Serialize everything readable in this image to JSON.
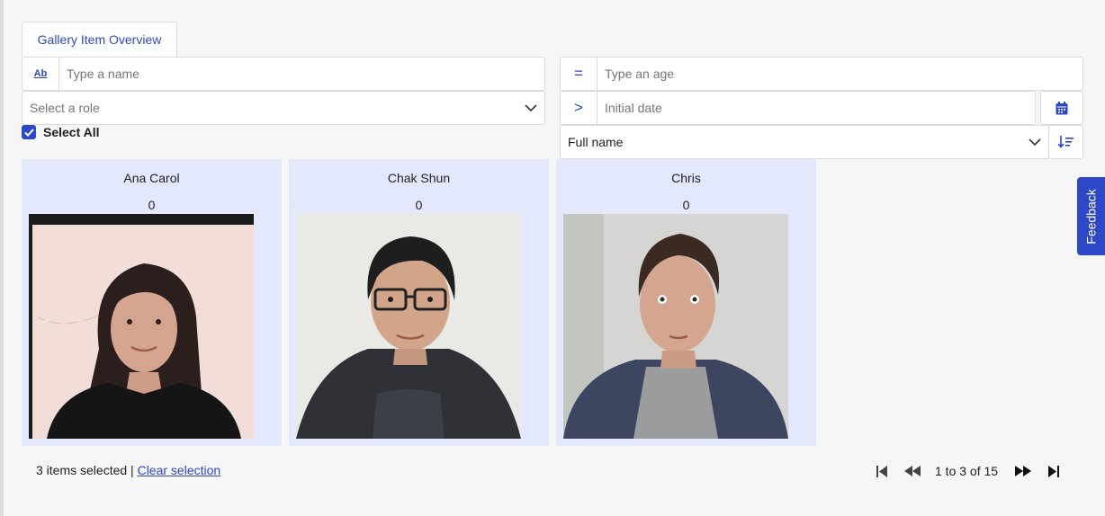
{
  "tab": {
    "label": "Gallery Item Overview"
  },
  "filters": {
    "name": {
      "prefix": "Ab",
      "placeholder": "Type a name"
    },
    "role": {
      "placeholder": "Select a role"
    },
    "age": {
      "prefix": "=",
      "placeholder": "Type an age"
    },
    "date": {
      "prefix": ">",
      "placeholder": "Initial date"
    },
    "sort": {
      "value": "Full name"
    }
  },
  "select_all": {
    "label": "Select All",
    "checked": true
  },
  "cards": [
    {
      "name": "Ana Carol",
      "count": "0"
    },
    {
      "name": "Chak Shun",
      "count": "0"
    },
    {
      "name": "Chris",
      "count": "0"
    }
  ],
  "footer": {
    "selected_text": "3 items selected |",
    "clear_label": "Clear selection",
    "page_text": "1 to 3 of 15"
  },
  "feedback": {
    "label": "Feedback"
  },
  "colors": {
    "accent": "#2d48c7",
    "card_bg": "#e3e8fd",
    "page_bg": "#f6f6f6"
  }
}
